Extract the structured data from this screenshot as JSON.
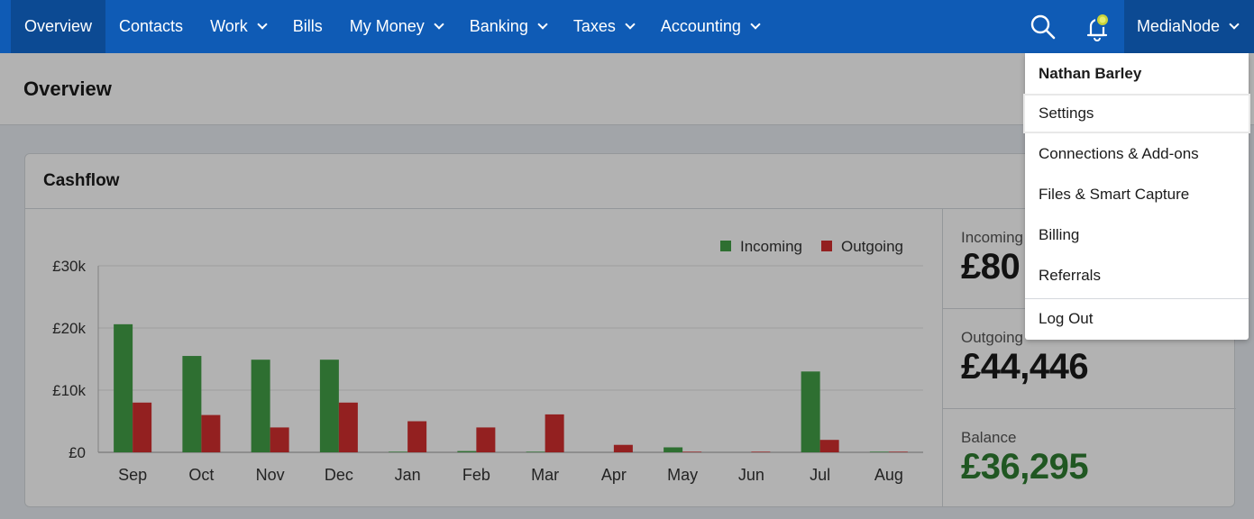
{
  "nav": {
    "items": [
      {
        "label": "Overview",
        "dropdown": false,
        "active": true
      },
      {
        "label": "Contacts",
        "dropdown": false
      },
      {
        "label": "Work",
        "dropdown": true
      },
      {
        "label": "Bills",
        "dropdown": false
      },
      {
        "label": "My Money",
        "dropdown": true
      },
      {
        "label": "Banking",
        "dropdown": true
      },
      {
        "label": "Taxes",
        "dropdown": true
      },
      {
        "label": "Accounting",
        "dropdown": true
      }
    ],
    "search_icon": "search-icon",
    "notification_icon": "bell-icon",
    "account_label": "MediaNode"
  },
  "page": {
    "title": "Overview"
  },
  "cashflow": {
    "title": "Cashflow",
    "incoming_label": "Incoming",
    "incoming_value": "£80",
    "outgoing_label": "Outgoing",
    "outgoing_value": "£44,446",
    "balance_label": "Balance",
    "balance_value": "£36,295"
  },
  "account_menu": {
    "user_name": "Nathan Barley",
    "items": [
      "Settings",
      "Connections & Add-ons",
      "Files & Smart Capture",
      "Billing",
      "Referrals",
      "Log Out"
    ]
  },
  "colors": {
    "nav_bg": "#0f5bb5",
    "incoming": "#43a047",
    "outgoing": "#d32f2f",
    "balance": "#2e7d32"
  },
  "chart_data": {
    "type": "bar",
    "categories": [
      "Sep",
      "Oct",
      "Nov",
      "Dec",
      "Jan",
      "Feb",
      "Mar",
      "Apr",
      "May",
      "Jun",
      "Jul",
      "Aug"
    ],
    "series": [
      {
        "name": "Incoming",
        "color": "#43a047",
        "values": [
          20600,
          15500,
          14900,
          14900,
          100,
          200,
          100,
          0,
          800,
          0,
          13000,
          100
        ]
      },
      {
        "name": "Outgoing",
        "color": "#d32f2f",
        "values": [
          8000,
          6000,
          4000,
          8000,
          5000,
          4000,
          6100,
          1200,
          100,
          100,
          2000,
          100
        ]
      }
    ],
    "yticks": [
      "£0",
      "£10k",
      "£20k",
      "£30k"
    ],
    "ylim": [
      0,
      30000
    ],
    "grid": true,
    "legend": "top-right"
  }
}
